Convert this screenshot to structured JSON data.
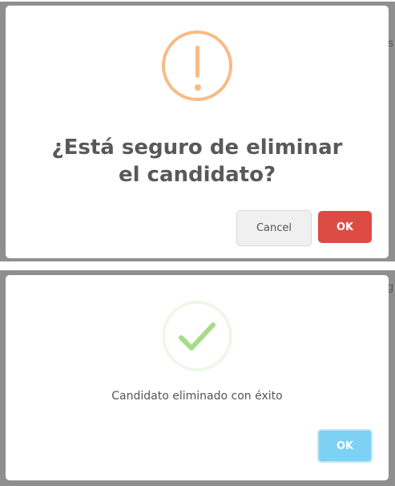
{
  "background": {
    "peek_text_1": "s",
    "peek_text_2": "g"
  },
  "confirm_dialog": {
    "icon": "warning-exclamation-icon",
    "title": "¿Está seguro de eliminar el candidato?",
    "cancel_label": "Cancel",
    "ok_label": "OK",
    "ok_color": "#dd4b44",
    "icon_color": "#f8bb86"
  },
  "success_dialog": {
    "icon": "success-check-icon",
    "message": "Candidato eliminado con éxito",
    "ok_label": "OK",
    "ok_color": "#7dd1f4",
    "icon_color": "#a5dc86"
  }
}
